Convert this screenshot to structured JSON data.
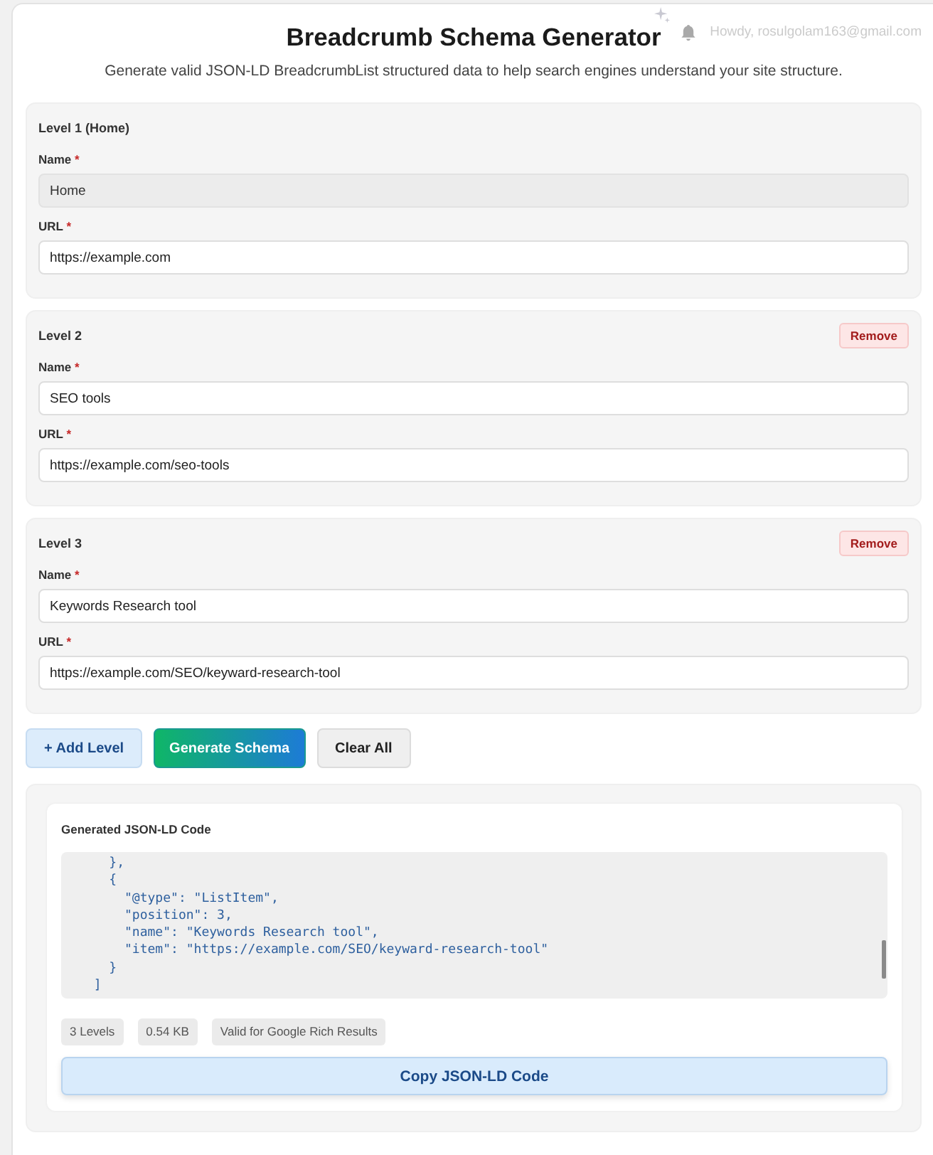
{
  "header": {
    "greeting": "Howdy, rosulgolam163@gmail.com"
  },
  "title": "Breadcrumb Schema Generator",
  "subtitle": "Generate valid JSON-LD BreadcrumbList structured data to help search engines understand your site structure.",
  "levels": [
    {
      "heading": "Level 1 (Home)",
      "fields": [
        {
          "label": "Name",
          "required_mark": "*",
          "value": "Home",
          "disabled": true
        },
        {
          "label": "URL",
          "required_mark": "*",
          "value": "https://example.com",
          "disabled": false
        }
      ]
    },
    {
      "heading": "Level 2",
      "remove": "Remove",
      "fields": [
        {
          "label": "Name",
          "required_mark": "*",
          "value": "SEO tools",
          "disabled": false
        },
        {
          "label": "URL",
          "required_mark": "*",
          "value": "https://example.com/seo-tools",
          "disabled": false
        }
      ]
    },
    {
      "heading": "Level 3",
      "remove": "Remove",
      "fields": [
        {
          "label": "Name",
          "required_mark": "*",
          "value": "Keywords Research tool",
          "disabled": false
        },
        {
          "label": "URL",
          "required_mark": "*",
          "value": "https://example.com/SEO/keyward-research-tool",
          "disabled": false
        }
      ]
    }
  ],
  "actions": [
    {
      "label": "+ Add Level",
      "kind": "secondary"
    },
    {
      "label": "Generate Schema",
      "kind": "primary"
    },
    {
      "label": "Clear All",
      "kind": "neutral"
    }
  ],
  "output": {
    "heading": "Generated JSON-LD Code",
    "code_lines": [
      "    },",
      "    {",
      "      \"@type\": \"ListItem\",",
      "      \"position\": 3,",
      "      \"name\": \"Keywords Research tool\",",
      "      \"item\": \"https://example.com/SEO/keyward-research-tool\"",
      "    }",
      "  ]"
    ],
    "badges": [
      "3 Levels",
      "0.54 KB",
      "Valid for Google Rich Results"
    ],
    "copy_button": "Copy JSON-LD Code"
  }
}
